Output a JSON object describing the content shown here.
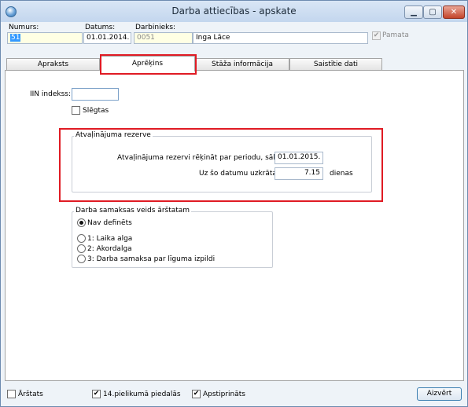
{
  "window": {
    "title": "Darba attiecības - apskate"
  },
  "header": {
    "numurs_label": "Numurs:",
    "numurs_value": "51",
    "datums_label": "Datums:",
    "datums_value": "01.01.2014.",
    "darbinieks_label": "Darbinieks:",
    "darbinieks_code": "0051",
    "darbinieks_name": "Inga Lāce",
    "pamata_label": "Pamata",
    "pamata_checked": true
  },
  "tabs": [
    {
      "label": "Apraksts",
      "active": false
    },
    {
      "label": "Aprēķins",
      "active": true
    },
    {
      "label": "Stāža informācija",
      "active": false
    },
    {
      "label": "Saistītie dati",
      "active": false
    }
  ],
  "calc": {
    "iin_label": "IIN indekss:",
    "iin_value": "",
    "slegtas_label": "Slēgtas",
    "slegtas_checked": false,
    "reserve": {
      "title": "Atvaļinājuma rezerve",
      "period_label": "Atvaļinājuma rezervi rēķināt par periodu, sākot no:",
      "period_value": "01.01.2015.",
      "accrued_label": "Uz šo datumu uzkrātas:",
      "accrued_value": "7.15",
      "accrued_unit": "dienas"
    },
    "wage": {
      "title": "Darba samaksas veids ārštatam",
      "options": [
        {
          "label": "Nav definēts",
          "selected": true
        },
        {
          "label": "1: Laika alga",
          "selected": false
        },
        {
          "label": "2: Akordalga",
          "selected": false
        },
        {
          "label": "3: Darba samaksa par līguma izpildi",
          "selected": false
        }
      ]
    }
  },
  "footer": {
    "arstats_label": "Ārštats",
    "arstats_checked": false,
    "pielikums_label": "14.pielikumā piedalās",
    "pielikums_checked": true,
    "apstiprinats_label": "Apstiprināts",
    "apstiprinats_checked": true,
    "close_label": "Aizvērt"
  },
  "icons": {
    "check": "✔"
  },
  "colors": {
    "highlight_red": "#e01b24",
    "selection_blue": "#3399ff",
    "field_yellow": "#ffffe4"
  }
}
